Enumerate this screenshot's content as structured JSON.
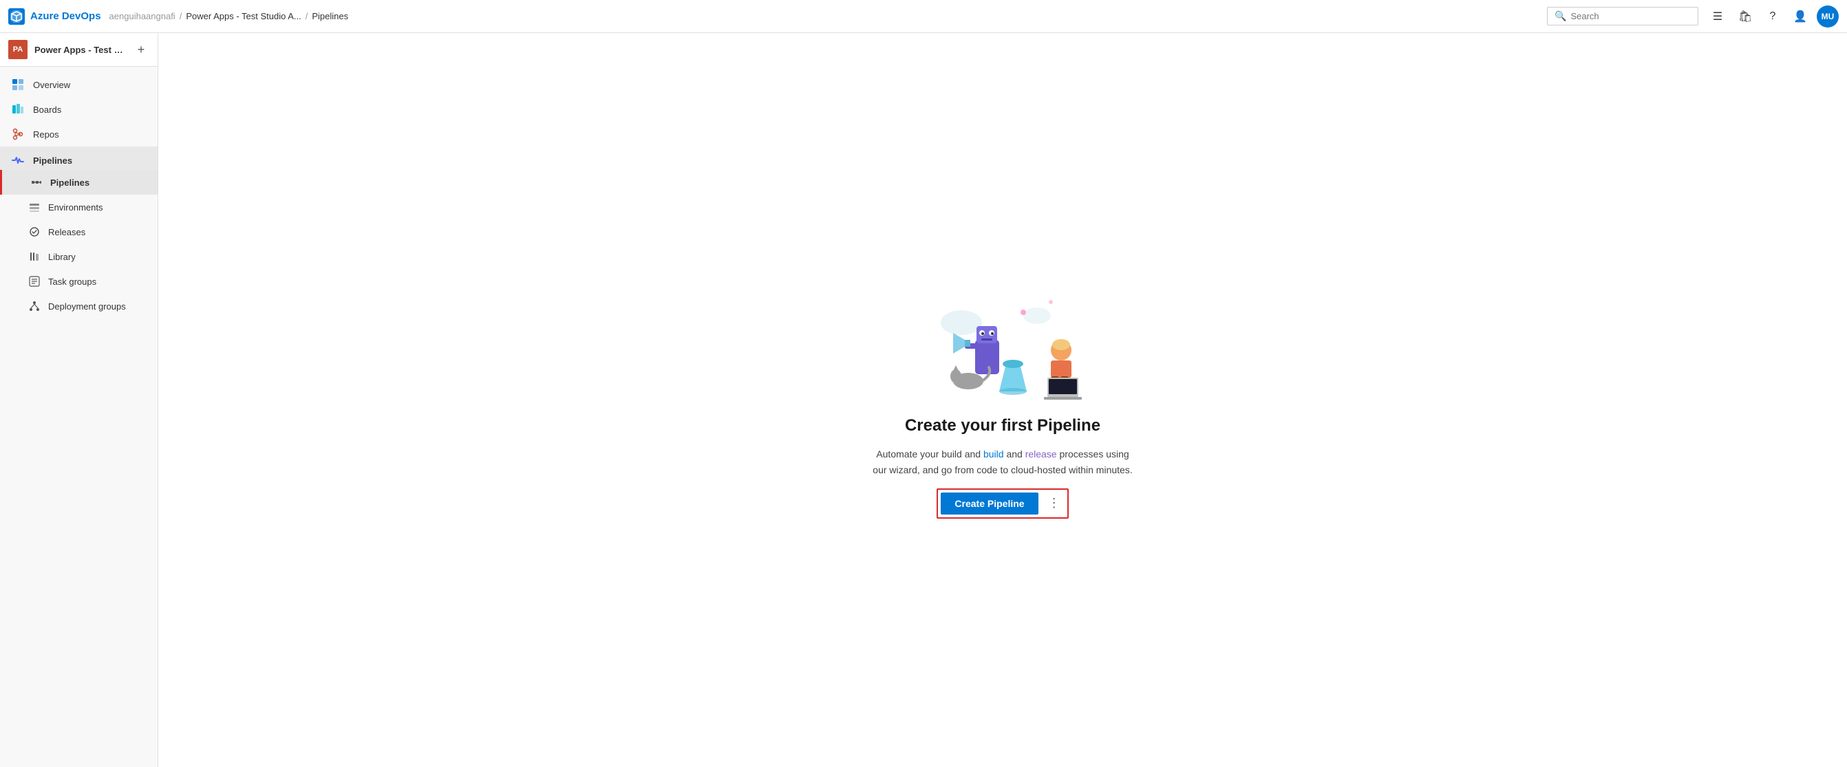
{
  "topbar": {
    "app_name": "Azure DevOps",
    "org_name": "aenguihaangnafi",
    "breadcrumb_sep1": "/",
    "project_name": "Power Apps - Test Studio A...",
    "breadcrumb_sep2": "/",
    "current_page": "Pipelines",
    "search_placeholder": "Search",
    "avatar_initials": "MU"
  },
  "sidebar": {
    "project_avatar": "PA",
    "project_name": "Power Apps - Test Stud...",
    "add_button": "+",
    "items": [
      {
        "id": "overview",
        "label": "Overview",
        "icon": "overview-icon"
      },
      {
        "id": "boards",
        "label": "Boards",
        "icon": "boards-icon"
      },
      {
        "id": "repos",
        "label": "Repos",
        "icon": "repos-icon"
      },
      {
        "id": "pipelines",
        "label": "Pipelines",
        "icon": "pipelines-icon"
      },
      {
        "id": "pipelines-sub",
        "label": "Pipelines",
        "icon": "pipelines-sub-icon",
        "selected": true
      },
      {
        "id": "environments",
        "label": "Environments",
        "icon": "environments-icon"
      },
      {
        "id": "releases",
        "label": "Releases",
        "icon": "releases-icon"
      },
      {
        "id": "library",
        "label": "Library",
        "icon": "library-icon"
      },
      {
        "id": "task-groups",
        "label": "Task groups",
        "icon": "taskgroups-icon"
      },
      {
        "id": "deployment-groups",
        "label": "Deployment groups",
        "icon": "deployment-icon"
      }
    ]
  },
  "main": {
    "title": "Create your first Pipeline",
    "description_part1": "Automate your build and",
    "description_link1": "build",
    "description_part2": "and release processes using our wizard, and go from code to cloud-hosted within minutes.",
    "description_release_link": "release",
    "create_button_label": "Create Pipeline",
    "more_button_label": "⋮"
  }
}
